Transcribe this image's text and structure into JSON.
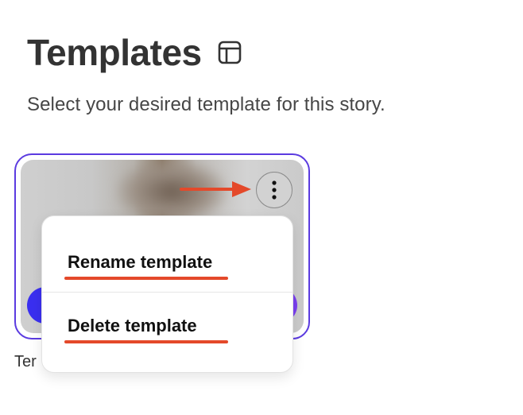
{
  "header": {
    "title": "Templates",
    "title_icon": "layout-icon",
    "subtitle": "Select your desired template for this story."
  },
  "card": {
    "caption": "Ter",
    "menu_icon": "more-vertical-icon",
    "border_color": "#5b3be0"
  },
  "context_menu": {
    "items": [
      {
        "label": "Rename template"
      },
      {
        "label": "Delete template"
      }
    ]
  },
  "annotations": {
    "arrow_icon": "arrow-right-icon",
    "highlight_color": "#e4492a"
  }
}
